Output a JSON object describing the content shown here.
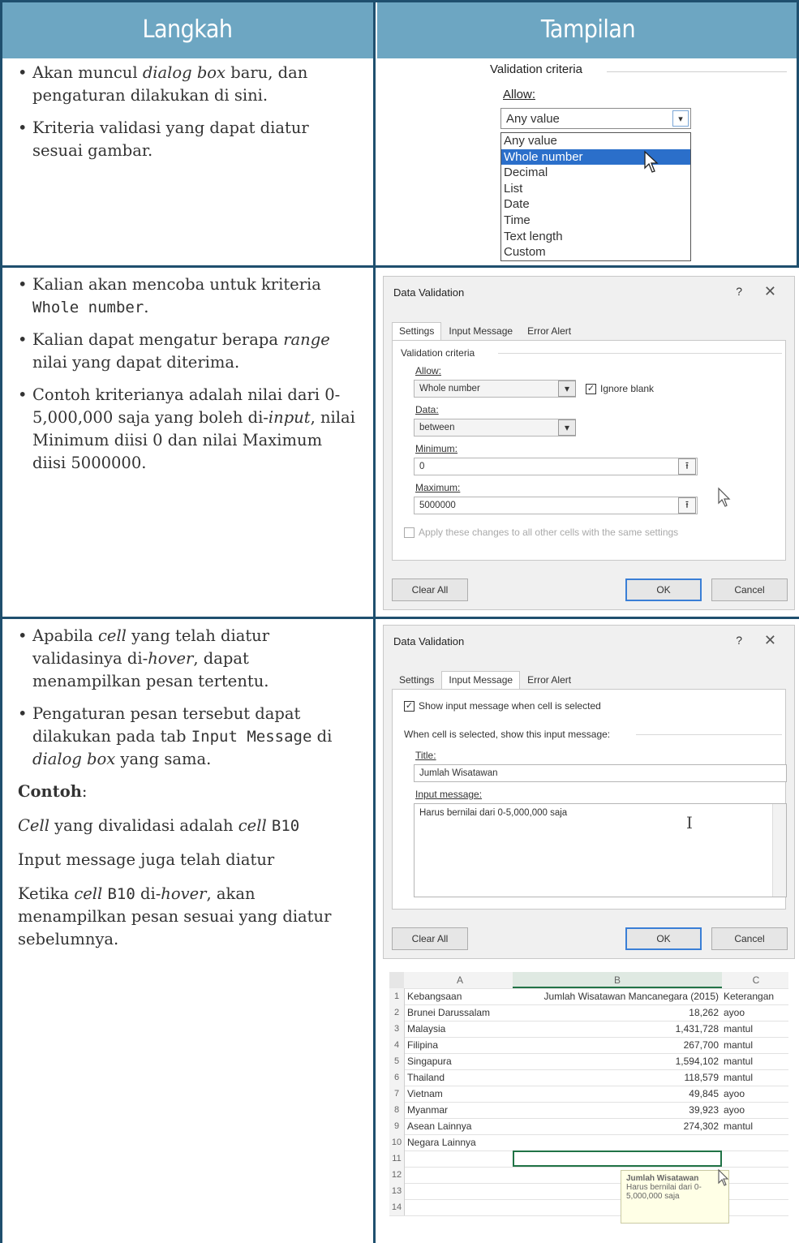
{
  "header": {
    "col1": "Langkah",
    "col2": "Tampilan"
  },
  "row1": {
    "b1_pre": "Akan muncul ",
    "b1_em": "dialog box",
    "b1_post": " baru, dan pengaturan dilakukan di sini.",
    "b2": "Kriteria validasi yang dapat diatur sesuai gambar.",
    "dropdown": {
      "title": "Validation criteria",
      "allow_label": "Allow:",
      "value": "Any value",
      "options": [
        "Any value",
        "Whole number",
        "Decimal",
        "List",
        "Date",
        "Time",
        "Text length",
        "Custom"
      ],
      "selected": "Whole number"
    }
  },
  "row2": {
    "b1_pre": "Kalian akan mencoba untuk kriteria ",
    "b1_code": "Whole number",
    "b1_post": ".",
    "b2_pre": "Kalian dapat mengatur berapa ",
    "b2_em": "range",
    "b2_post": " nilai yang dapat diterima.",
    "b3_pre": "Contoh kriterianya adalah nilai dari 0-5,000,000 saja yang boleh di-",
    "b3_em": "input",
    "b3_post": ",  nilai Minimum diisi 0 dan nilai Maximum diisi 5000000.",
    "dialog": {
      "title": "Data Validation",
      "help": "?",
      "close": "✕",
      "tabs": [
        "Settings",
        "Input Message",
        "Error Alert"
      ],
      "criteria_label": "Validation criteria",
      "allow_label": "Allow:",
      "allow_value": "Whole number",
      "ignore_blank": "Ignore blank",
      "data_label": "Data:",
      "data_value": "between",
      "min_label": "Minimum:",
      "min_value": "0",
      "max_label": "Maximum:",
      "max_value": "5000000",
      "apply_label": "Apply these changes to all other cells with the same settings",
      "clear_all": "Clear All",
      "ok": "OK",
      "cancel": "Cancel"
    }
  },
  "row3": {
    "b1_pre": "Apabila ",
    "b1_em1": "cell",
    "b1_mid": " yang telah diatur validasinya di-",
    "b1_em2": "hover",
    "b1_post": ", dapat menampilkan pesan tertentu.",
    "b2_pre": "Pengaturan pesan tersebut dapat dilakukan pada tab ",
    "b2_code": "Input Message",
    "b2_mid": " di ",
    "b2_em": "dialog box",
    "b2_post": " yang sama.",
    "contoh": "Contoh",
    "p1_em": "Cell",
    "p1_mid": " yang divalidasi adalah ",
    "p1_em2": "cell",
    "p1_code": "B10",
    "p2": "Input message juga telah diatur",
    "p3_pre": "Ketika ",
    "p3_em": "cell",
    "p3_code": "B10",
    "p3_mid": " di-",
    "p3_em2": "hover",
    "p3_post": ", akan menampilkan pesan sesuai yang diatur sebelumnya.",
    "dialog": {
      "title": "Data Validation",
      "help": "?",
      "close": "✕",
      "tabs": [
        "Settings",
        "Input Message",
        "Error Alert"
      ],
      "show_msg": "Show input message when cell is selected",
      "when_label": "When cell is selected, show this input message:",
      "title_label": "Title:",
      "title_value": "Jumlah Wisatawan",
      "msg_label": "Input message:",
      "msg_value": "Harus bernilai dari 0-5,000,000 saja",
      "clear_all": "Clear All",
      "ok": "OK",
      "cancel": "Cancel"
    },
    "sheet": {
      "col_headers": [
        "A",
        "B",
        "C"
      ],
      "rows": [
        [
          "1",
          "Kebangsaan",
          "Jumlah  Wisatawan Mancanegara (2015)",
          "Keterangan"
        ],
        [
          "2",
          "Brunei Darussalam",
          "18,262",
          "ayoo"
        ],
        [
          "3",
          "Malaysia",
          "1,431,728",
          "mantul"
        ],
        [
          "4",
          "Filipina",
          "267,700",
          "mantul"
        ],
        [
          "5",
          "Singapura",
          "1,594,102",
          "mantul"
        ],
        [
          "6",
          "Thailand",
          "118,579",
          "mantul"
        ],
        [
          "7",
          "Vietnam",
          "49,845",
          "ayoo"
        ],
        [
          "8",
          "Myanmar",
          "39,923",
          "ayoo"
        ],
        [
          "9",
          "Asean Lainnya",
          "274,302",
          "mantul"
        ],
        [
          "10",
          "Negara Lainnya",
          "",
          ""
        ],
        [
          "11",
          "",
          "",
          ""
        ],
        [
          "12",
          "",
          "",
          ""
        ],
        [
          "13",
          "",
          "",
          ""
        ],
        [
          "14",
          "",
          "",
          ""
        ]
      ],
      "tooltip_title": "Jumlah Wisatawan",
      "tooltip_body": "Harus bernilai dari 0-5,000,000 saja"
    }
  }
}
